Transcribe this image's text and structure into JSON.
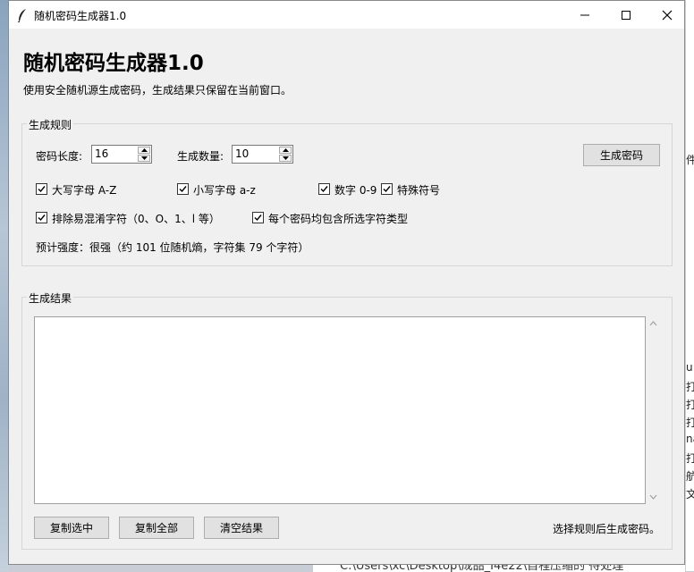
{
  "window": {
    "title": "随机密码生成器1.0"
  },
  "header": {
    "title": "随机密码生成器1.0",
    "subtitle": "使用安全随机源生成密码，生成结果只保留在当前窗口。"
  },
  "rules": {
    "group_label": "生成规则",
    "length_label": "密码长度:",
    "length_value": "16",
    "count_label": "生成数量:",
    "count_value": "10",
    "generate_button": "生成密码",
    "options": [
      {
        "label": "大写字母 A-Z",
        "checked": true
      },
      {
        "label": "小写字母 a-z",
        "checked": true
      },
      {
        "label": "数字 0-9",
        "checked": true
      },
      {
        "label": "特殊符号",
        "checked": true
      },
      {
        "label": "排除易混淆字符（0、O、1、l 等）",
        "checked": true
      },
      {
        "label": "每个密码均包含所选字符类型",
        "checked": true
      }
    ],
    "strength_text": "预计强度：很强（约 101 位随机熵，字符集 79 个字符）"
  },
  "results": {
    "group_label": "生成结果",
    "copy_selected": "复制选中",
    "copy_all": "复制全部",
    "clear": "清空结果",
    "status": "选择规则后生成密码。"
  },
  "background": {
    "bottom_text": "C:\\Users\\xc\\Desktop\\成品_I4e22\\自程压缩的 待处理",
    "right_chars": [
      "件",
      "u",
      "打",
      "打",
      "打",
      "na",
      "打",
      "航",
      "文"
    ]
  }
}
